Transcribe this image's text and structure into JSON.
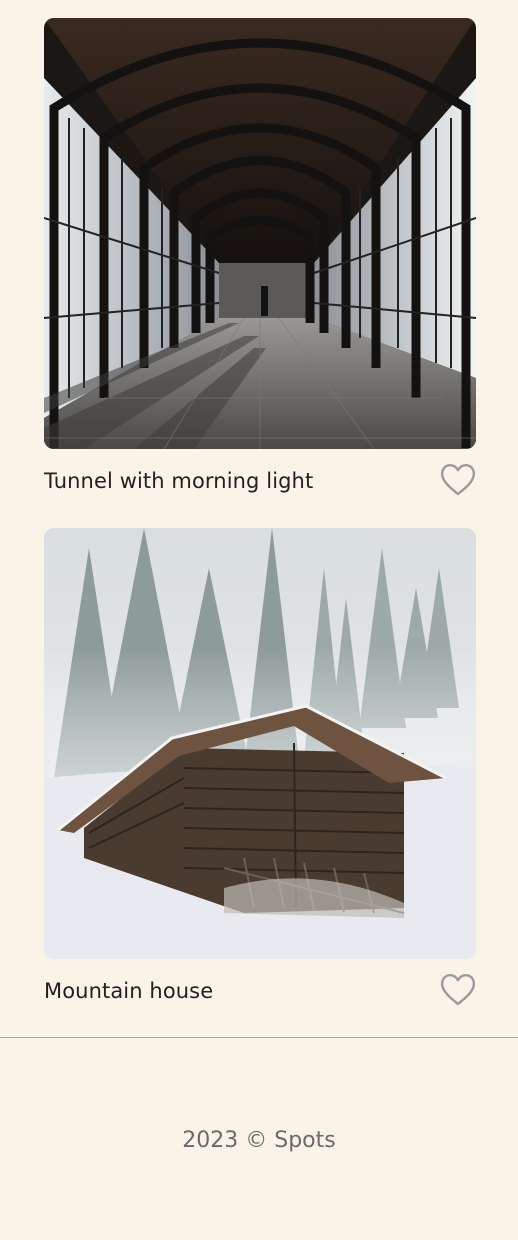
{
  "cards": [
    {
      "title": "Tunnel with morning light",
      "image_alt": "Tunnel with morning light",
      "like_icon": "heart-outline-icon"
    },
    {
      "title": "Mountain house",
      "image_alt": "Mountain house",
      "like_icon": "heart-outline-icon"
    }
  ],
  "footer": {
    "copyright": "2023 © Spots"
  },
  "colors": {
    "background": "#FAF4E8",
    "text": "#212121",
    "footer_text": "#6B6B6B",
    "icon_stroke": "#9A9A9A",
    "divider": "#A8A8A8"
  }
}
